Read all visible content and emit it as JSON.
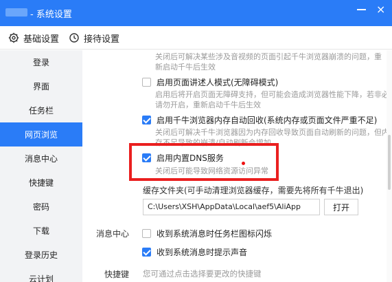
{
  "window": {
    "title": "- 系统设置",
    "close_glyph": "×",
    "accent": "#2a7cf7"
  },
  "tabs": [
    {
      "label": "基础设置",
      "icon": "gear-icon"
    },
    {
      "label": "接待设置",
      "icon": "clock-icon"
    }
  ],
  "sidebar": {
    "items": [
      {
        "label": "登录"
      },
      {
        "label": "界面"
      },
      {
        "label": "任务栏"
      },
      {
        "label": "网页浏览",
        "active": true
      },
      {
        "label": "消息中心"
      },
      {
        "label": "快捷键"
      },
      {
        "label": "密码"
      },
      {
        "label": "下载"
      },
      {
        "label": "登录历史"
      },
      {
        "label": "云计划"
      }
    ]
  },
  "content": {
    "top_desc_line1": "关闭后可解决某些涉及音视频的页面引起千牛浏览器崩溃的问题，重",
    "top_desc_line2": "新启动千牛后生效",
    "narrator": {
      "label": "启用页面讲述人模式(无障碍模式)",
      "checked": false,
      "desc_line1": "启用后将开启页面无障碍支持，但可能会造成浏览器性能下降，若非必要，",
      "desc_line2": "请勿开启，重新启动千牛后生效"
    },
    "memory_recycle": {
      "label": "启用千牛浏览器内存自动回收(系统内存或页面文件严重不足)",
      "checked": true,
      "desc_line1": "关闭后可解决千牛浏览器因为内存回收导致页面自动刷新的问题，但内",
      "desc_line2": "存不足导致的崩溃/自动刷新会增加"
    },
    "dns": {
      "label": "启用内置DNS服务",
      "checked": true,
      "desc": "关闭后可能导致网络资源访问异常"
    },
    "cache": {
      "label": "缓存文件夹(可手动清理浏览器缓存，需要先将所有千牛退出)",
      "path": "C:\\Users\\XSH\\AppData\\Local\\aef5\\AliApp",
      "open_button": "打开"
    },
    "message_center": {
      "section_label": "消息中心",
      "flash_label": "收到系统消息时任务栏图标闪烁",
      "flash_checked": false,
      "sound_label": "收到系统消息时提示声音",
      "sound_checked": true
    },
    "shortcut": {
      "section_label": "快捷键",
      "desc": "您可通过点击选择要更改的快捷键"
    }
  }
}
